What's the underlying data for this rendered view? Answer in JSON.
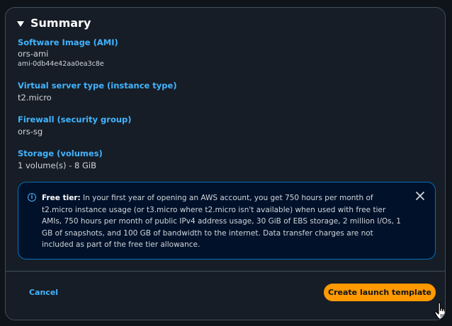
{
  "summary": {
    "title": "Summary"
  },
  "sections": [
    {
      "label": "Software Image (AMI)",
      "value": "ors-ami",
      "sub": "ami-0db44e42aa0ea3c8e"
    },
    {
      "label": "Virtual server type (instance type)",
      "value": "t2.micro"
    },
    {
      "label": "Firewall (security group)",
      "value": "ors-sg"
    },
    {
      "label": "Storage (volumes)",
      "value": "1 volume(s) - 8 GiB"
    }
  ],
  "alert": {
    "bold": "Free tier:",
    "text": " In your first year of opening an AWS account, you get 750 hours per month of t2.micro instance usage (or t3.micro where t2.micro isn't available) when used with free tier AMIs, 750 hours per month of public IPv4 address usage, 30 GiB of EBS storage, 2 million I/Os, 1 GB of snapshots, and 100 GB of bandwidth to the internet. Data transfer charges are not included as part of the free tier allowance."
  },
  "footer": {
    "cancel_label": "Cancel",
    "primary_label": "Create launch template"
  },
  "colors": {
    "accent": "#42b4ff",
    "primary": "#ff9900",
    "background": "#161d26",
    "alert_border": "#0073bb"
  },
  "icons": {
    "collapse": "caret-down-icon",
    "info": "info-icon",
    "dismiss": "close-icon",
    "pointer": "hand-cursor-icon"
  }
}
